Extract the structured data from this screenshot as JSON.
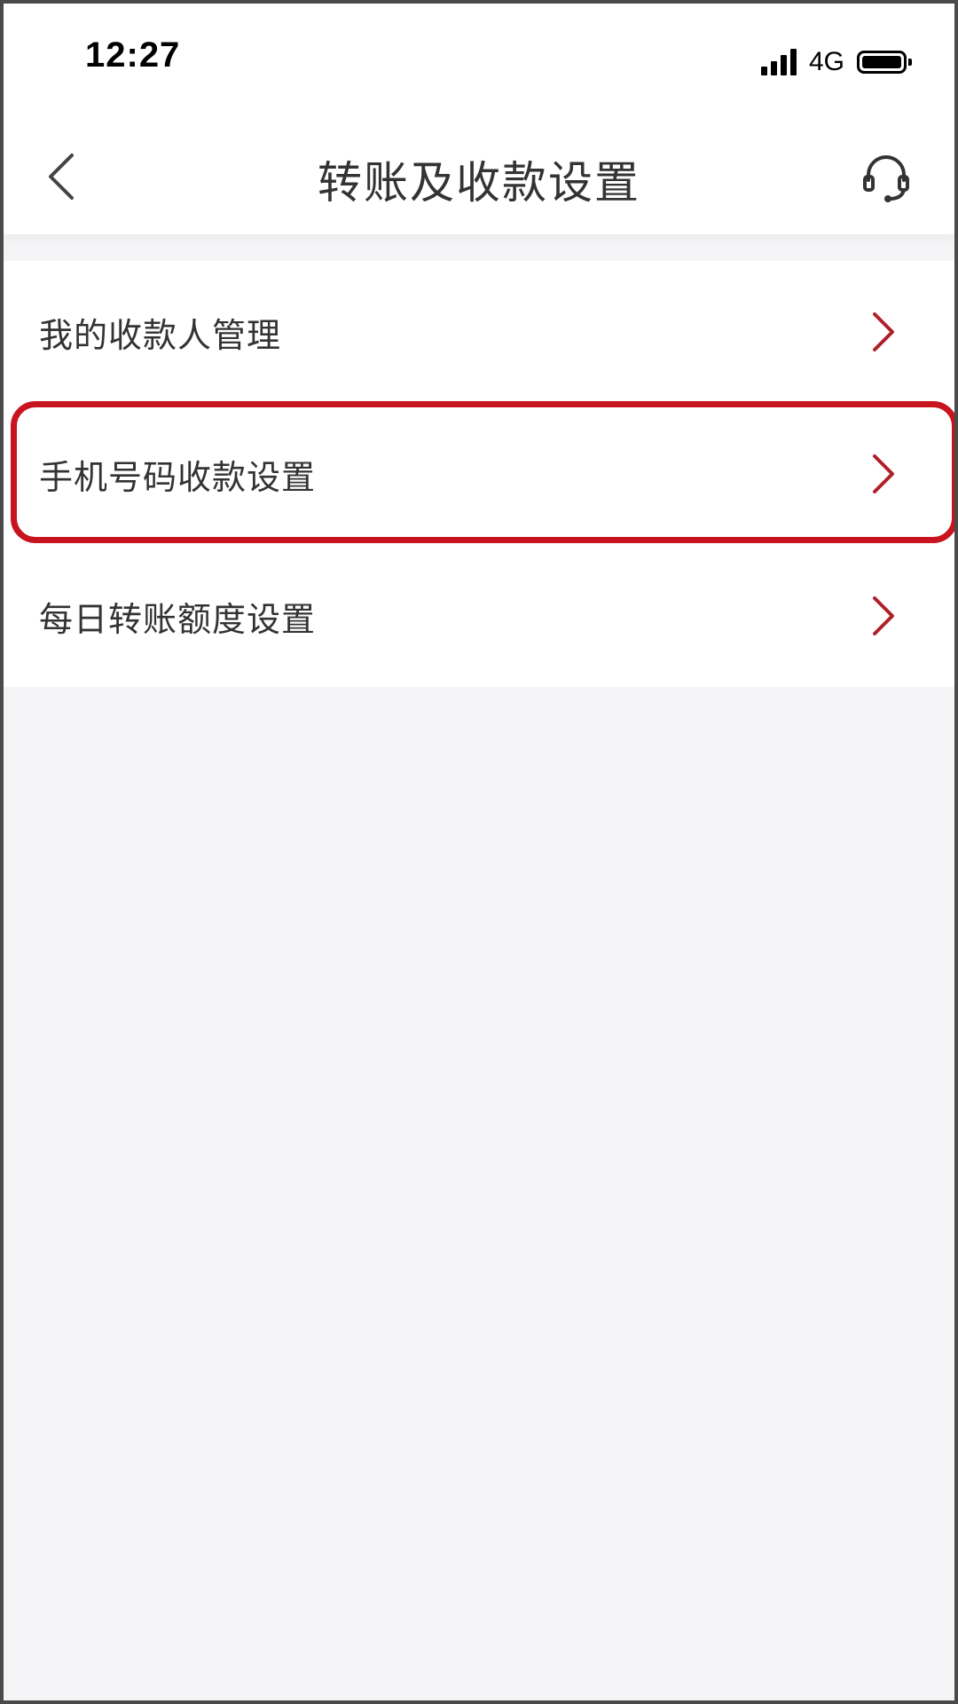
{
  "status_bar": {
    "time": "12:27",
    "network": "4G"
  },
  "header": {
    "title": "转账及收款设置",
    "back_icon": "chevron-left-icon",
    "service_icon": "headset-icon"
  },
  "menu": {
    "items": [
      {
        "label": "我的收款人管理",
        "highlighted": false
      },
      {
        "label": "手机号码收款设置",
        "highlighted": true
      },
      {
        "label": "每日转账额度设置",
        "highlighted": false
      }
    ]
  },
  "colors": {
    "chevron": "#b0202a",
    "highlight_border": "#c8141e",
    "background": "#f5f4f6"
  }
}
